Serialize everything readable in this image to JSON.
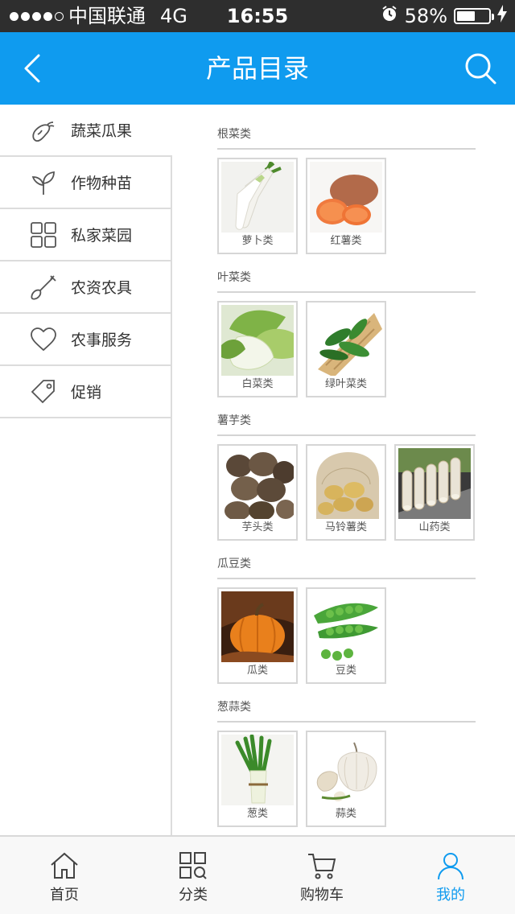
{
  "status_bar": {
    "carrier": "中国联通",
    "network": "4G",
    "time": "16:55",
    "battery": "58%",
    "battery_level": 0.58
  },
  "header": {
    "title": "产品目录",
    "back_icon": "chevron-left-icon",
    "search_icon": "search-icon",
    "color": "#0f9bef"
  },
  "sidebar": {
    "items": [
      {
        "label": "蔬菜瓜果",
        "icon": "eggplant-icon"
      },
      {
        "label": "作物种苗",
        "icon": "sprout-icon"
      },
      {
        "label": "私家菜园",
        "icon": "grid-icon"
      },
      {
        "label": "农资农具",
        "icon": "shovel-icon"
      },
      {
        "label": "农事服务",
        "icon": "heart-icon"
      },
      {
        "label": "促销",
        "icon": "tag-icon"
      }
    ]
  },
  "categories": [
    {
      "title": "根菜类",
      "items": [
        {
          "label": "萝卜类",
          "icon": "radish-image"
        },
        {
          "label": "红薯类",
          "icon": "sweet-potato-image"
        }
      ]
    },
    {
      "title": "叶菜类",
      "items": [
        {
          "label": "白菜类",
          "icon": "cabbage-image"
        },
        {
          "label": "绿叶菜类",
          "icon": "leafy-greens-image"
        }
      ]
    },
    {
      "title": "薯芋类",
      "items": [
        {
          "label": "芋头类",
          "icon": "taro-image"
        },
        {
          "label": "马铃薯类",
          "icon": "potato-image"
        },
        {
          "label": "山药类",
          "icon": "yam-image"
        }
      ]
    },
    {
      "title": "瓜豆类",
      "items": [
        {
          "label": "瓜类",
          "icon": "pumpkin-image"
        },
        {
          "label": "豆类",
          "icon": "peas-image"
        }
      ]
    },
    {
      "title": "葱蒜类",
      "items": [
        {
          "label": "葱类",
          "icon": "scallion-image"
        },
        {
          "label": "蒜类",
          "icon": "garlic-image"
        }
      ]
    }
  ],
  "tabbar": {
    "active_color": "#0f9bef",
    "tabs": [
      {
        "label": "首页",
        "icon": "home-icon"
      },
      {
        "label": "分类",
        "icon": "category-icon"
      },
      {
        "label": "购物车",
        "icon": "cart-icon"
      },
      {
        "label": "我的",
        "icon": "user-icon"
      }
    ]
  }
}
